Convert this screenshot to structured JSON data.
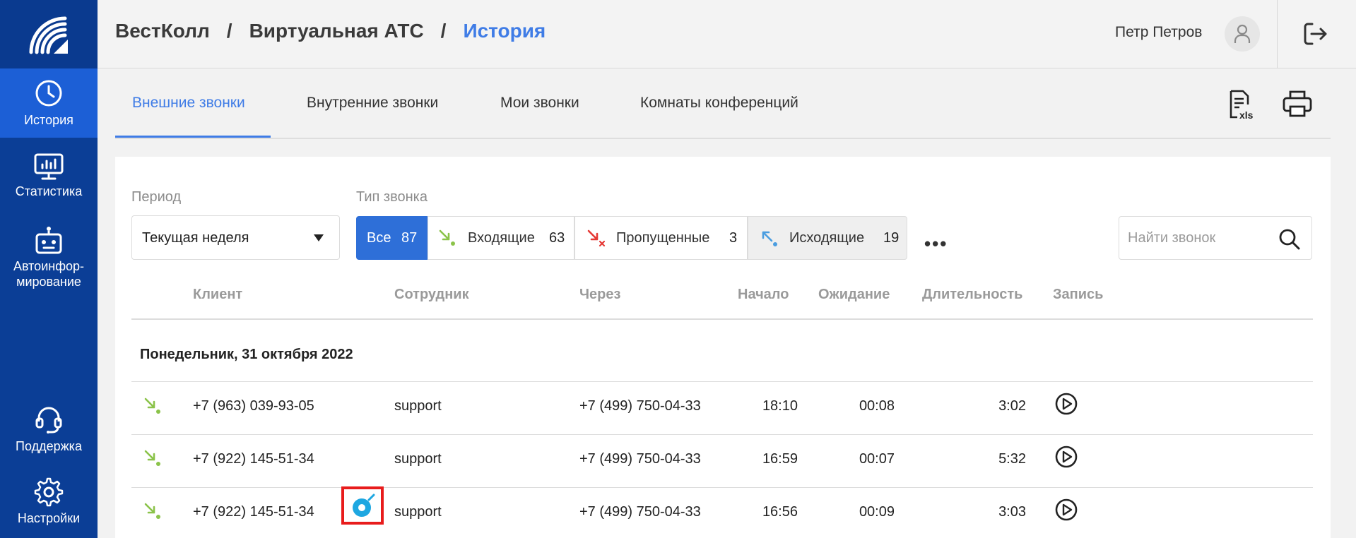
{
  "sidebar": {
    "items": [
      {
        "label": "История",
        "icon": "clock-icon"
      },
      {
        "label": "Статистика",
        "icon": "chart-monitor-icon"
      },
      {
        "label": "Автоинфор-мирование",
        "label_line1": "Автоинфор-",
        "label_line2": "мирование",
        "icon": "robot-icon"
      },
      {
        "label": "Поддержка",
        "icon": "headset-icon"
      },
      {
        "label": "Настройки",
        "icon": "gear-icon"
      }
    ]
  },
  "header": {
    "breadcrumb": [
      "ВестКолл",
      "Виртуальная АТС",
      "История"
    ],
    "separator": "/",
    "user_name": "Петр Петров"
  },
  "tabs": [
    "Внешние звонки",
    "Внутренние звонки",
    "Мои звонки",
    "Комнаты конференций"
  ],
  "filters": {
    "period_label": "Период",
    "period_value": "Текущая неделя",
    "type_label": "Тип звонка",
    "types": [
      {
        "label": "Все",
        "count": "87"
      },
      {
        "label": "Входящие",
        "count": "63"
      },
      {
        "label": "Пропущенные",
        "count": "3"
      },
      {
        "label": "Исходящие",
        "count": "19"
      }
    ],
    "more": "•••",
    "search_placeholder": "Найти звонок"
  },
  "table": {
    "columns": [
      "Клиент",
      "Сотрудник",
      "Через",
      "Начало",
      "Ожидание",
      "Длительность",
      "Запись"
    ],
    "day_header": "Понедельник, 31 октября 2022",
    "rows": [
      {
        "type": "incoming",
        "client": "+7 (963) 039-93-05",
        "employee": "support",
        "via": "+7 (499) 750-04-33",
        "start": "18:10",
        "wait": "00:08",
        "duration": "3:02"
      },
      {
        "type": "incoming",
        "client": "+7 (922) 145-51-34",
        "employee": "support",
        "via": "+7 (499) 750-04-33",
        "start": "16:59",
        "wait": "00:07",
        "duration": "5:32"
      },
      {
        "type": "incoming",
        "client": "+7 (922) 145-51-34",
        "employee": "support",
        "via": "+7 (499) 750-04-33",
        "start": "16:56",
        "wait": "00:09",
        "duration": "3:03"
      }
    ]
  },
  "colors": {
    "sidebar_bg": "#0b3e96",
    "sidebar_active": "#1c5fd6",
    "accent": "#3f7ce6",
    "incoming_green": "#8bc34a",
    "missed_red": "#e53935",
    "outgoing_blue": "#4a9de0",
    "highlight_red": "#e81c1c"
  }
}
